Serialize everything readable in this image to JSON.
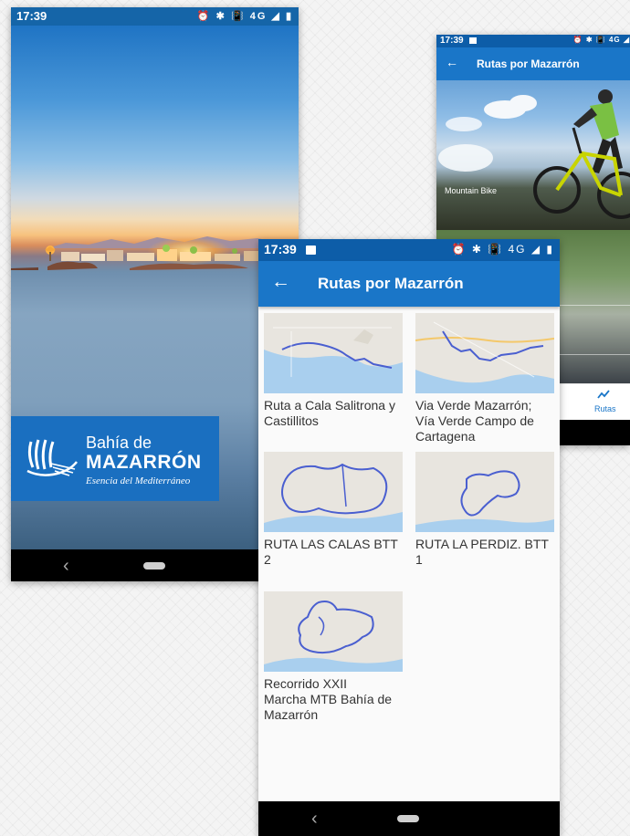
{
  "splash": {
    "status_time": "17:39",
    "status_icons": "⏰ ✱ 📳 4G ◢ ▮",
    "logo_line1": "Bahía de",
    "logo_line2": "MAZARRÓN",
    "logo_tagline": "Esencia del Mediterráneo",
    "nav_back": "‹"
  },
  "back_screen": {
    "status_time": "17:39",
    "status_icons": "⏰ ✱ 📳 4G ◢",
    "back_icon": "←",
    "title": "Rutas por Mazarrón",
    "cards": [
      {
        "label": "Mountain Bike"
      }
    ],
    "bottom_nav": {
      "active_label": "Rutas",
      "active_icon": "route-trend-icon"
    }
  },
  "routes_screen": {
    "status_time": "17:39",
    "status_icons": "⏰ ✱ 📳 4G ◢ ▮",
    "back_icon": "←",
    "title": "Rutas por Mazarrón",
    "routes": [
      {
        "name": "Ruta a Cala Salitrona y\nCastillitos"
      },
      {
        "name": "Via Verde Mazarrón;\nVía Verde  Campo de\nCartagena"
      },
      {
        "name": "RUTA LAS CALAS BTT\n2"
      },
      {
        "name": "RUTA  LA PERDIZ. BTT\n1"
      },
      {
        "name": "Recorrido XXII\nMarcha MTB Bahía de\nMazarrón"
      }
    ],
    "nav_back": "‹"
  },
  "colors": {
    "primary": "#1a76c8",
    "status_bar": "#0d5da8",
    "route_line": "#4a5fd0",
    "sea": "#a9cfee",
    "land": "#e8e5df"
  }
}
